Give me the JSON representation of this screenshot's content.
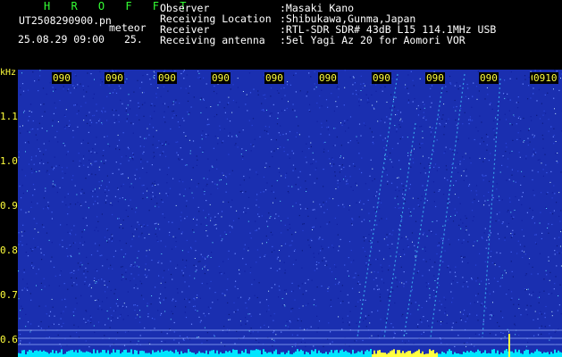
{
  "header": {
    "brand": "H R O F F T",
    "filename": "UT2508290900.pn",
    "event_type": "meteor",
    "date_time": "25.08.29 09:00",
    "count": "25.",
    "info": [
      {
        "label": "Observer",
        "value": ":Masaki Kano"
      },
      {
        "label": "Receiving Location",
        "value": ":Shibukawa,Gunma,Japan"
      },
      {
        "label": "Receiver",
        "value": ":RTL-SDR SDR# 43dB L15 114.1MHz USB"
      },
      {
        "label": "Receiving antenna",
        "value": ":5el Yagi Az 20 for Aomori VOR"
      }
    ]
  },
  "axes": {
    "y_unit": "kHz",
    "y_ticks": [
      "1.1",
      "1.0",
      "0.9",
      "0.8",
      "0.7",
      "0.6"
    ],
    "x_ticks": [
      "090",
      "090",
      "090",
      "090",
      "090",
      "090",
      "090",
      "090",
      "090",
      "090",
      "0910"
    ]
  },
  "colors": {
    "background": "#000000",
    "spectrogram": "#1a2fb0",
    "header_green": "#34ff34",
    "tick_yellow": "#ffff3c",
    "signal_cyan": "#00e6ff"
  }
}
